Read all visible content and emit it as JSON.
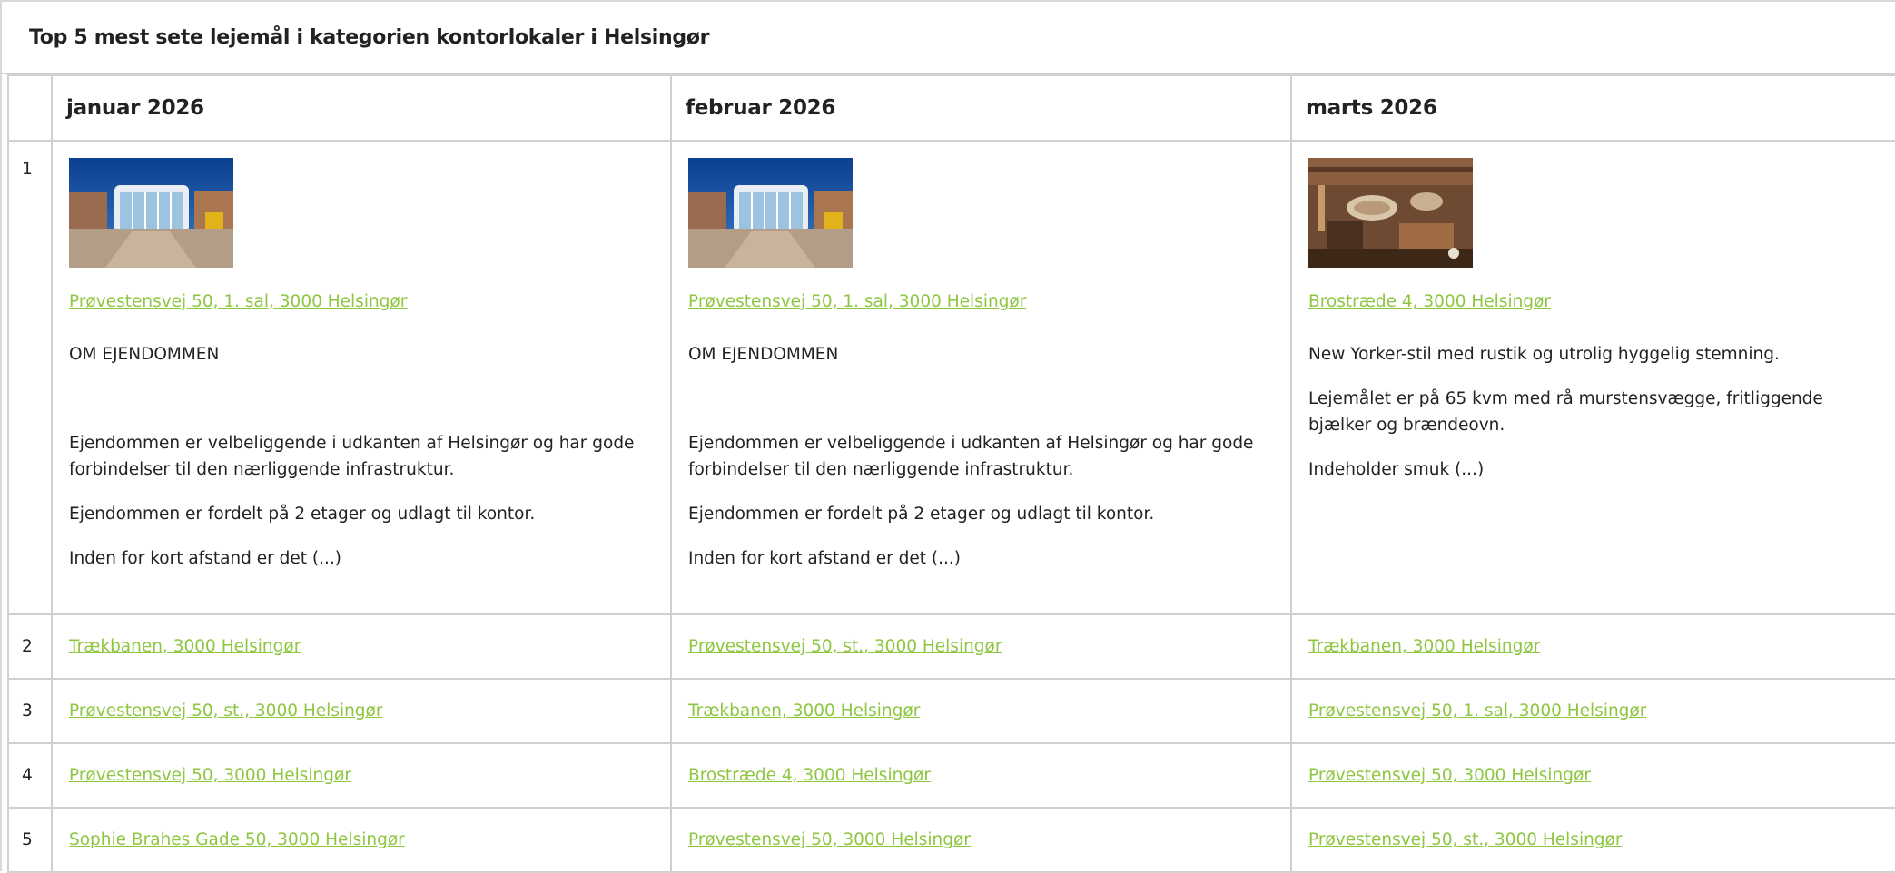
{
  "title": "Top 5 mest sete lejemål i kategorien kontorlokaler i Helsingør",
  "columns": [
    "januar 2026",
    "februar 2026",
    "marts 2026"
  ],
  "top": {
    "rank": "1",
    "jan": {
      "image_name": "office-building-photo",
      "address": "Prøvestensvej 50, 1. sal, 3000 Helsingør",
      "p1": "OM EJENDOMMEN",
      "p2": "Ejendommen er velbeliggende i udkanten af Helsingør og har gode forbindelser til den nærliggende infrastruktur.",
      "p3": "Ejendommen er fordelt på 2 etager og udlagt til kontor.",
      "p4": "Inden for kort afstand er det (...)"
    },
    "feb": {
      "image_name": "office-building-photo",
      "address": "Prøvestensvej 50, 1. sal, 3000 Helsingør",
      "p1": "OM EJENDOMMEN",
      "p2": "Ejendommen er velbeliggende i udkanten af Helsingør og har gode forbindelser til den nærliggende infrastruktur.",
      "p3": "Ejendommen er fordelt på 2 etager og udlagt til kontor.",
      "p4": "Inden for kort afstand er det (...)"
    },
    "mar": {
      "image_name": "rustic-interior-photo",
      "address": "Brostræde 4, 3000 Helsingør",
      "p1": "New Yorker-stil med rustik og utrolig hyggelig stemning.",
      "p2": "Lejemålet er på 65 kvm med rå murstensvægge, fritliggende bjælker og brændeovn.",
      "p3": "Indeholder smuk (...)"
    }
  },
  "rows": [
    {
      "rank": "2",
      "jan": "Trækbanen, 3000 Helsingør",
      "feb": "Prøvestensvej 50, st., 3000 Helsingør",
      "mar": "Trækbanen, 3000 Helsingør"
    },
    {
      "rank": "3",
      "jan": "Prøvestensvej 50, st., 3000 Helsingør",
      "feb": "Trækbanen, 3000 Helsingør",
      "mar": "Prøvestensvej 50, 1. sal, 3000 Helsingør"
    },
    {
      "rank": "4",
      "jan": "Prøvestensvej 50, 3000 Helsingør",
      "feb": "Brostræde 4, 3000 Helsingør",
      "mar": "Prøvestensvej 50, 3000 Helsingør"
    },
    {
      "rank": "5",
      "jan": "Sophie Brahes Gade 50, 3000 Helsingør",
      "feb": "Prøvestensvej 50, 3000 Helsingør",
      "mar": "Prøvestensvej 50, st., 3000 Helsingør"
    }
  ],
  "colors": {
    "link": "#8dc63f",
    "border": "#d0d0d0"
  }
}
